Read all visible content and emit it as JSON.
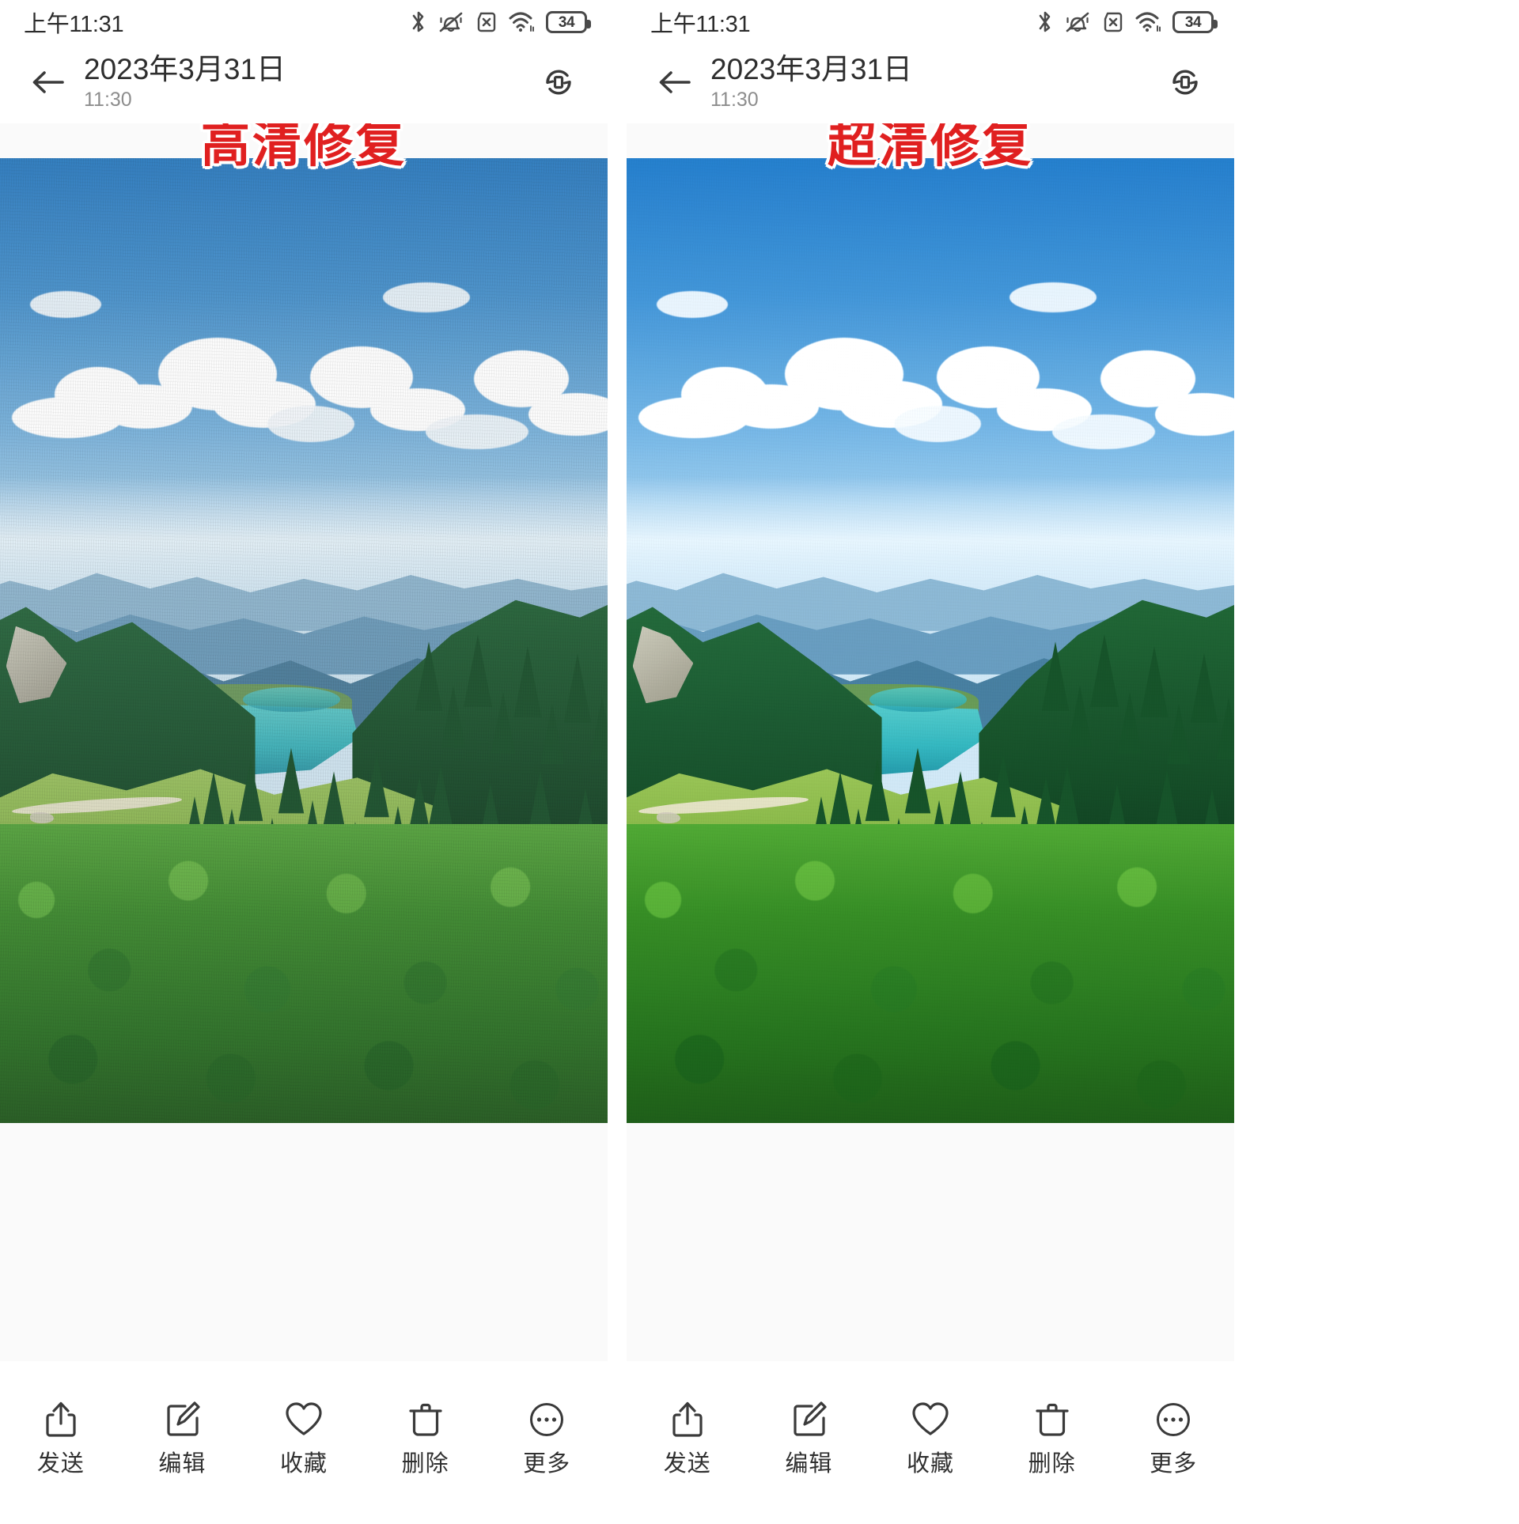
{
  "meta": {
    "panel_count": 2,
    "accent_red": "#e02020",
    "text_dark": "#2e2e2e",
    "text_muted": "#8d8d8d"
  },
  "status_bar": {
    "time": "上午11:31",
    "battery_level": "34",
    "icons": [
      "bluetooth-icon",
      "silent-bell-icon",
      "sim-card-off-icon",
      "wifi-icon",
      "battery-icon"
    ]
  },
  "header": {
    "back_icon": "back-arrow-icon",
    "title": "2023年3月31日",
    "subtitle": "11:30",
    "rotate_icon": "auto-rotate-icon"
  },
  "panels": [
    {
      "id": "panel-hd",
      "overlay_label": "高清修复"
    },
    {
      "id": "panel-ultra",
      "overlay_label": "超清修复"
    }
  ],
  "toolbar": {
    "items": [
      {
        "icon": "share-icon",
        "label": "发送"
      },
      {
        "icon": "edit-icon",
        "label": "编辑"
      },
      {
        "icon": "heart-icon",
        "label": "收藏"
      },
      {
        "icon": "trash-icon",
        "label": "删除"
      },
      {
        "icon": "more-icon",
        "label": "更多"
      }
    ]
  },
  "photo": {
    "subject": "山脉 湖泊 森林 风景照",
    "description": "蓝天白云 远山 绿色针叶林 碧绿湖水 草地"
  }
}
